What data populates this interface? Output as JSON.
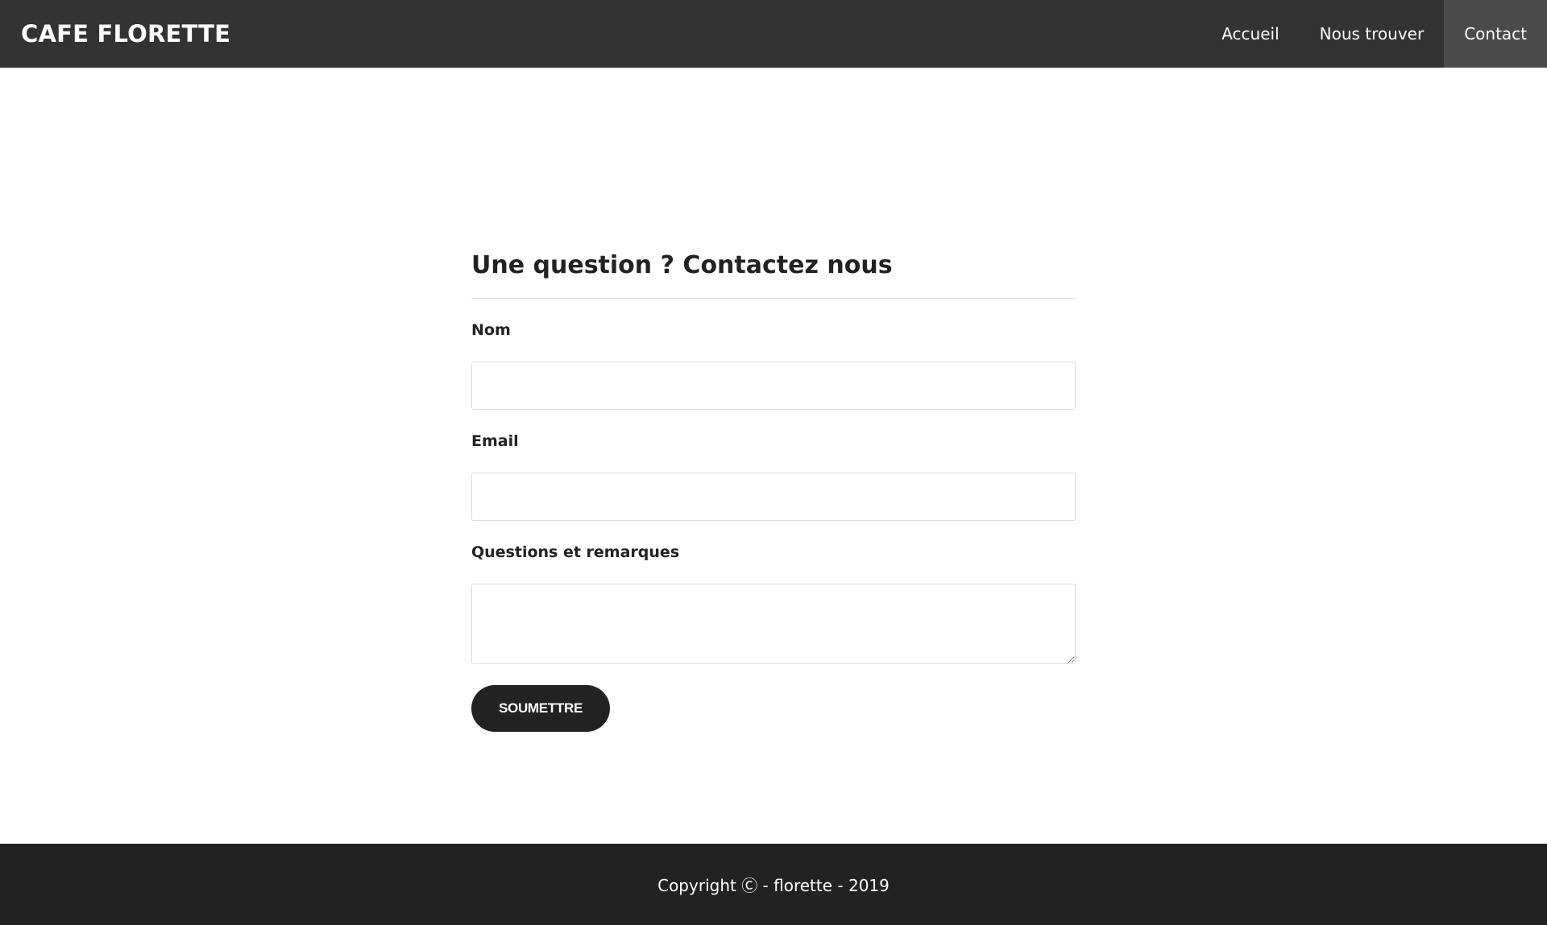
{
  "navbar": {
    "brand": "CAFE FLORETTE",
    "links": [
      {
        "label": "Accueil",
        "active": false
      },
      {
        "label": "Nous trouver",
        "active": false
      },
      {
        "label": "Contact",
        "active": true
      }
    ]
  },
  "contact_form": {
    "title": "Une question ? Contactez nous",
    "name_label": "Nom",
    "name_value": "",
    "email_label": "Email",
    "email_value": "",
    "questions_label": "Questions et remarques",
    "questions_value": "",
    "submit_label": "SOUMETTRE"
  },
  "footer": {
    "copyright": "Copyright Ⓒ - florette - 2019"
  },
  "colors": {
    "navbar_bg": "#333333",
    "nav_active_bg": "#4a4a4a",
    "footer_bg": "#222222",
    "button_bg": "#222222",
    "text": "#222222"
  }
}
